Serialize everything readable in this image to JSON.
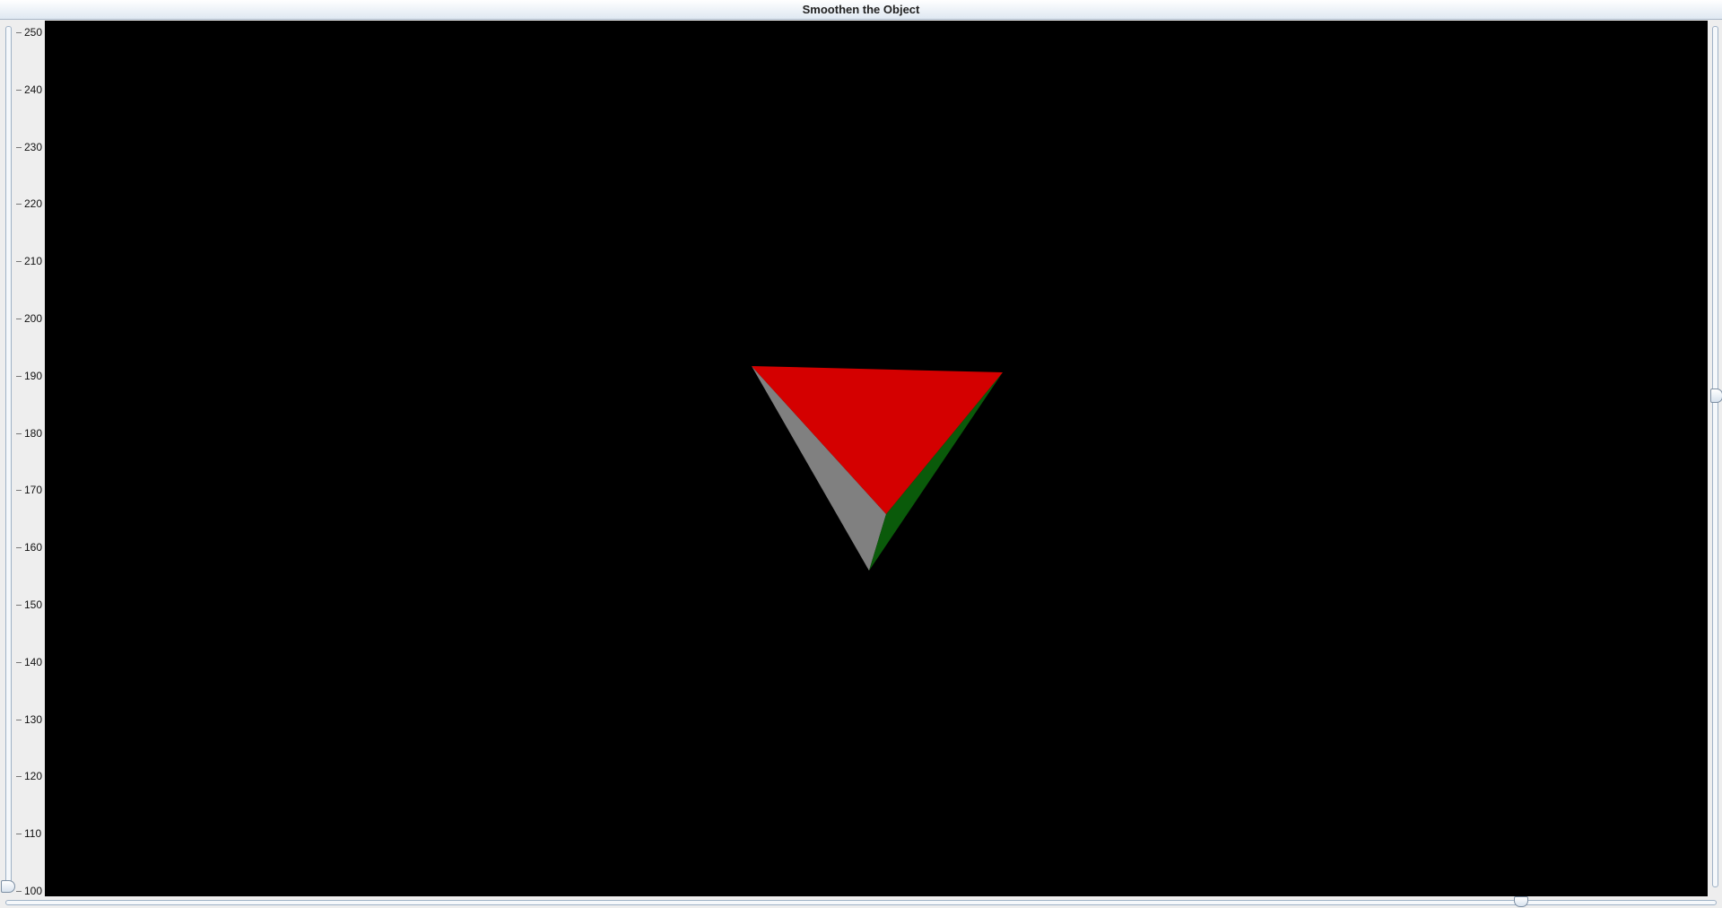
{
  "window": {
    "title": "Smoothen the Object"
  },
  "left_slider": {
    "min": 100,
    "max": 250,
    "value": 100,
    "tick_labels": [
      "250",
      "240",
      "230",
      "220",
      "210",
      "200",
      "190",
      "180",
      "170",
      "160",
      "150",
      "140",
      "130",
      "120",
      "110",
      "100"
    ]
  },
  "right_slider": {
    "min": 0,
    "max": 100,
    "value": 58
  },
  "bottom_slider": {
    "min": 0,
    "max": 100,
    "value": 91
  },
  "object": {
    "faces": [
      {
        "name": "front-face",
        "color": "#d40000"
      },
      {
        "name": "left-face",
        "color": "#808080"
      },
      {
        "name": "right-face",
        "color": "#0a5a0a"
      }
    ]
  }
}
